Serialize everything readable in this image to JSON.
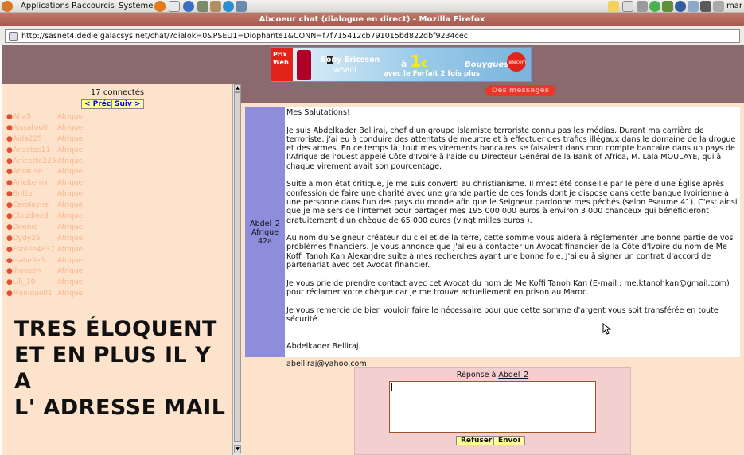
{
  "panel": {
    "menus": [
      "Applications",
      "Raccourcis",
      "Système"
    ],
    "clock": "mar"
  },
  "window": {
    "title": "Abcoeur chat (dialogue en direct) - Mozilla Firefox"
  },
  "urlbar": {
    "url": "http://sasnet4.dedie.galacsys.net/chat/?dialok=0&PSEU1=Diophante1&CONN=f7f715412cb791015bd822dbf9234cec"
  },
  "banner": {
    "prix": "Prix Web",
    "brand": "Sony Ericsson",
    "model": "W580i",
    "price_prefix": "à",
    "price": "1",
    "price_suffix": "€",
    "offer": "avec le Forfait 2 fois plus",
    "operator": "Bouygues",
    "operator_sub": "Telecom"
  },
  "users_panel": {
    "count_label": "17 connectés",
    "prev_label": "< Préc",
    "next_label": "Suiv >",
    "users": [
      {
        "name": "Afia5",
        "country": "Afrique"
      },
      {
        "name": "Aissatou0",
        "country": "Afrique"
      },
      {
        "name": "Aida225",
        "country": "Afrique"
      },
      {
        "name": "Anastas11",
        "country": "Afrique"
      },
      {
        "name": "Anicette225",
        "country": "Afrique"
      },
      {
        "name": "Anrause",
        "country": "Afrique"
      },
      {
        "name": "Arielterrix",
        "country": "Afrique"
      },
      {
        "name": "Britte",
        "country": "Afrique"
      },
      {
        "name": "Carolayne",
        "country": "Afrique"
      },
      {
        "name": "Claudine3",
        "country": "Afrique"
      },
      {
        "name": "Doonie",
        "country": "Afrique"
      },
      {
        "name": "Dydy25",
        "country": "Afrique"
      },
      {
        "name": "Estelle4837",
        "country": "Afrique"
      },
      {
        "name": "Isabelle5",
        "country": "Afrique"
      },
      {
        "name": "Jhonson",
        "country": "Afrique"
      },
      {
        "name": "Lili_10",
        "country": "Afrique"
      },
      {
        "name": "Monique01",
        "country": "Afrique"
      }
    ]
  },
  "overlay": {
    "line1": "TRES ÉLOQUENT",
    "line2": "ET EN PLUS IL Y A",
    "line3": "L' ADRESSE MAIL"
  },
  "messages": {
    "header_button": "Des messages",
    "sender_name": "Abdel_2",
    "sender_country": "Afrique",
    "sender_age": "42a",
    "paragraphs": [
      "Mes Salutations!",
      "Je suis Abdelkader Belliraj, chef d'un groupe Islamiste terroriste connu pas les médias. Durant ma carrière de terroriste, j'ai eu à conduire des attentats de meurtre et à effectuer des trafics illégaux dans le domaine de la drogue et des armes. En ce temps là, tout mes virements bancaires se faisaient dans mon compte bancaire dans un pays de l'Afrique de l'ouest appelé Côte d'Ivoire à l'aide du Directeur Général de la Bank of Africa, M. Lala MOULAYE, qui à chaque virement avait son pourcentage.",
      "Suite à mon état critique, je me suis converti au christianisme. Il m'est été conseillé par le père d'une Église après confession de faire une charité avec une grande partie de ces fonds dont je dispose dans cette banque Ivoirienne à une personne dans l'un des pays du monde afin que le Seigneur pardonne mes péchés (selon Psaume 41). C'est ainsi que je me sers de l'internet pour partager mes 195 000 000 euros à environ 3 000 chanceux qui bénéficieront gratuitement d'un chèque de 65 000 euros (vingt milles euros ).",
      "Au nom du Seigneur créateur du ciel et de la terre, cette somme vous aidera à réglementer une bonne partie de vos problèmes financiers. Je vous annonce que j'ai eu à contacter un Avocat financier de la Côte d'Ivoire du nom de Me Koffi Tanoh Kan Alexandre suite à mes recherches ayant une bonne foie. J'ai eu à signer un contrat d'accord de partenariat avec cet Avocat financier.",
      "Je vous prie de prendre contact avec cet Avocat du nom de Me Koffi Tanoh Kan (E-mail : me.ktanohkan@gmail.com) pour réclamer votre chèque car je me trouve actuellement en prison au Maroc.",
      "Je vous remercie de bien vouloir faire le nécessaire pour que cette somme d'argent vous soit transférée en toute sécurité."
    ],
    "signature": "Abdelkader Belliraj",
    "email": "abelliraj@yahoo.com"
  },
  "reply": {
    "label_prefix": "Réponse à",
    "label_name": "Abdel_2",
    "refuse_label": "Refuser",
    "send_label": "Envoi"
  }
}
